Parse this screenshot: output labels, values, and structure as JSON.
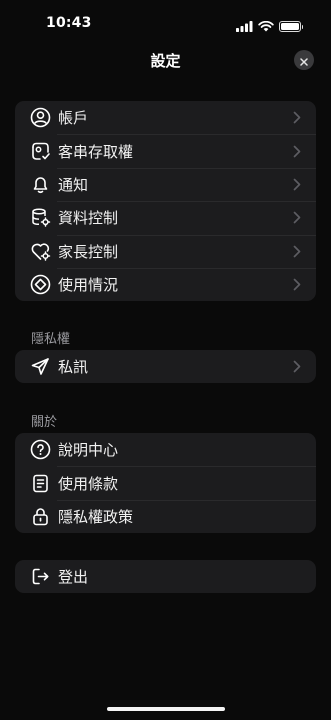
{
  "status": {
    "time": "10:43"
  },
  "header": {
    "title": "設定"
  },
  "main_group": [
    {
      "label": "帳戶",
      "icon": "user-circle-icon"
    },
    {
      "label": "客串存取權",
      "icon": "cameo-access-icon"
    },
    {
      "label": "通知",
      "icon": "bell-icon"
    },
    {
      "label": "資料控制",
      "icon": "database-gear-icon"
    },
    {
      "label": "家長控制",
      "icon": "heart-shield-icon"
    },
    {
      "label": "使用情況",
      "icon": "usage-diamond-icon"
    }
  ],
  "privacy": {
    "heading": "隱私權",
    "items": [
      {
        "label": "私訊",
        "icon": "paper-plane-icon"
      }
    ]
  },
  "about": {
    "heading": "關於",
    "items": [
      {
        "label": "說明中心",
        "icon": "help-circle-icon"
      },
      {
        "label": "使用條款",
        "icon": "document-icon"
      },
      {
        "label": "隱私權政策",
        "icon": "lock-icon"
      }
    ]
  },
  "logout": {
    "label": "登出",
    "icon": "logout-icon"
  }
}
